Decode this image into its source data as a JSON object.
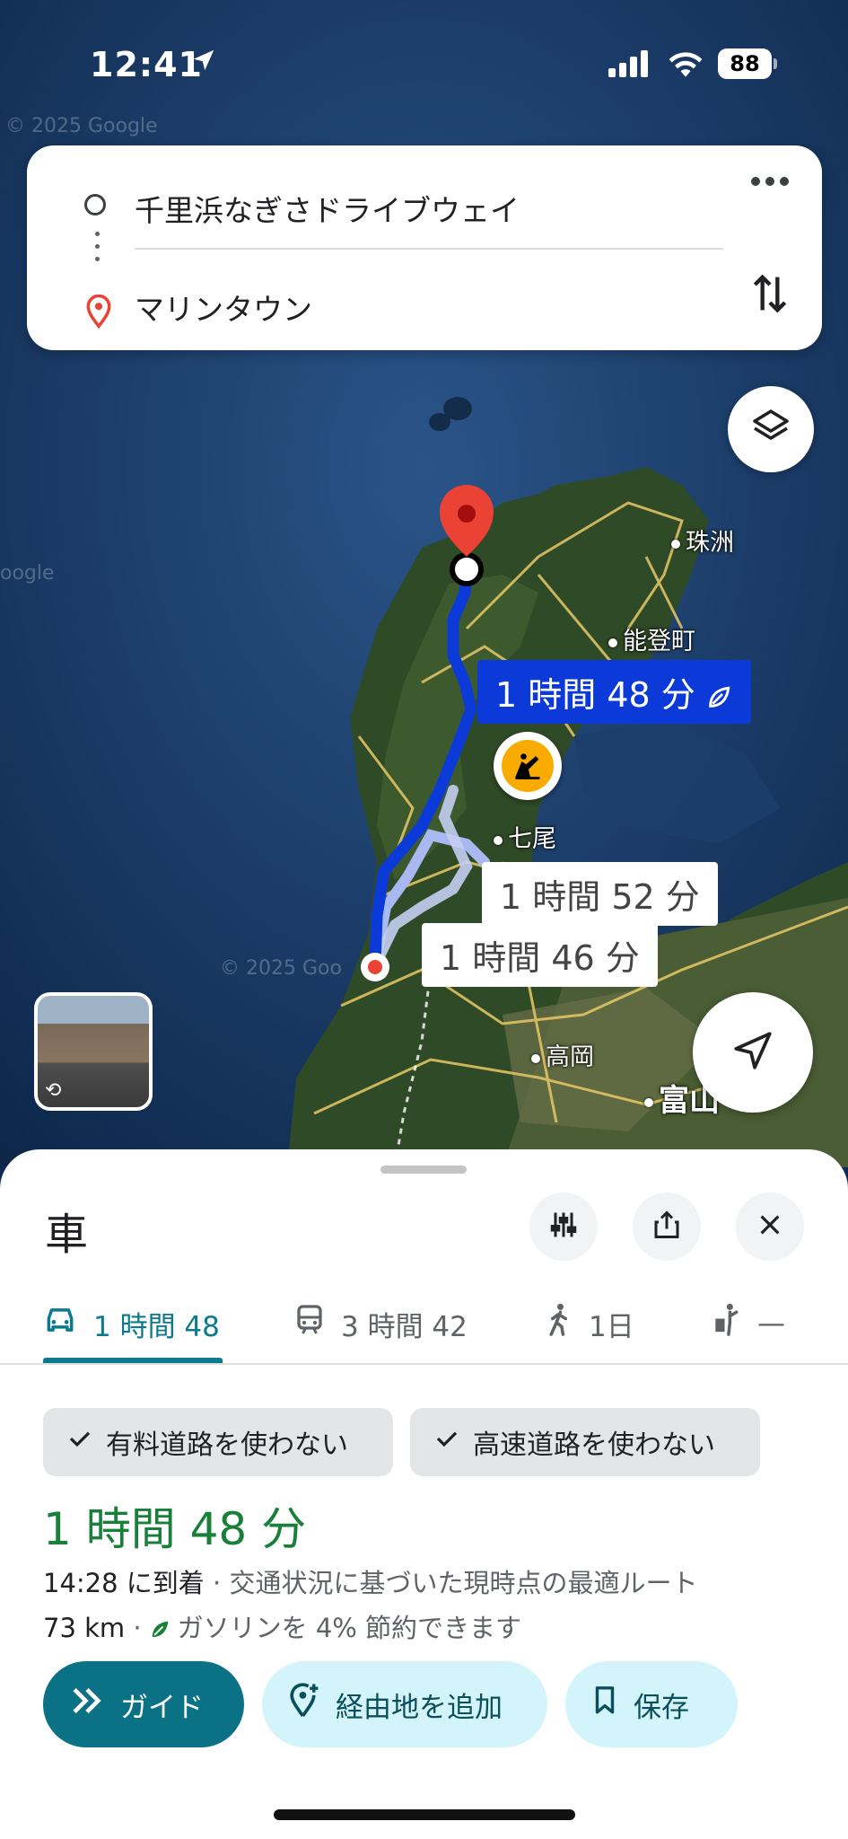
{
  "status_bar": {
    "time": "12:41",
    "battery": "88"
  },
  "route": {
    "origin": "千里浜なぎさドライブウェイ",
    "destination": "マリンタウン"
  },
  "map": {
    "places": [
      "珠洲",
      "能登町",
      "七尾",
      "高岡",
      "富山"
    ],
    "watermarks": [
      "© 2025 Google",
      "oogle",
      "© 2025 Goo"
    ],
    "route_labels": {
      "primary": "1 時間 48 分",
      "alt1": "1 時間 52 分",
      "alt2": "1 時間 46 分"
    },
    "colors": {
      "primary_route": "#0b3ad9",
      "alt_route": "#a8b8f0",
      "roads": "#e8c866"
    }
  },
  "sheet": {
    "title": "車",
    "tabs": [
      {
        "label": "1 時間 48",
        "icon": "car-icon",
        "active": true
      },
      {
        "label": "3 時間 42",
        "icon": "train-icon",
        "active": false
      },
      {
        "label": "1日",
        "icon": "walk-icon",
        "active": false
      },
      {
        "label": "—",
        "icon": "ride-icon",
        "active": false
      }
    ],
    "chips": [
      "有料道路を使わない",
      "高速道路を使わない"
    ],
    "duration": "1 時間 48 分",
    "arrival_time": "14:28",
    "arrival_suffix": "に到着",
    "arrival_desc": "· 交通状況に基づいた現時点の最適ルート",
    "distance": "73 km",
    "saving": "ガソリンを 4% 節約できます",
    "actions": {
      "guide": "ガイド",
      "add_stop": "経由地を追加",
      "save": "保存"
    },
    "accent": "#0b7285",
    "duration_color": "#188038"
  }
}
